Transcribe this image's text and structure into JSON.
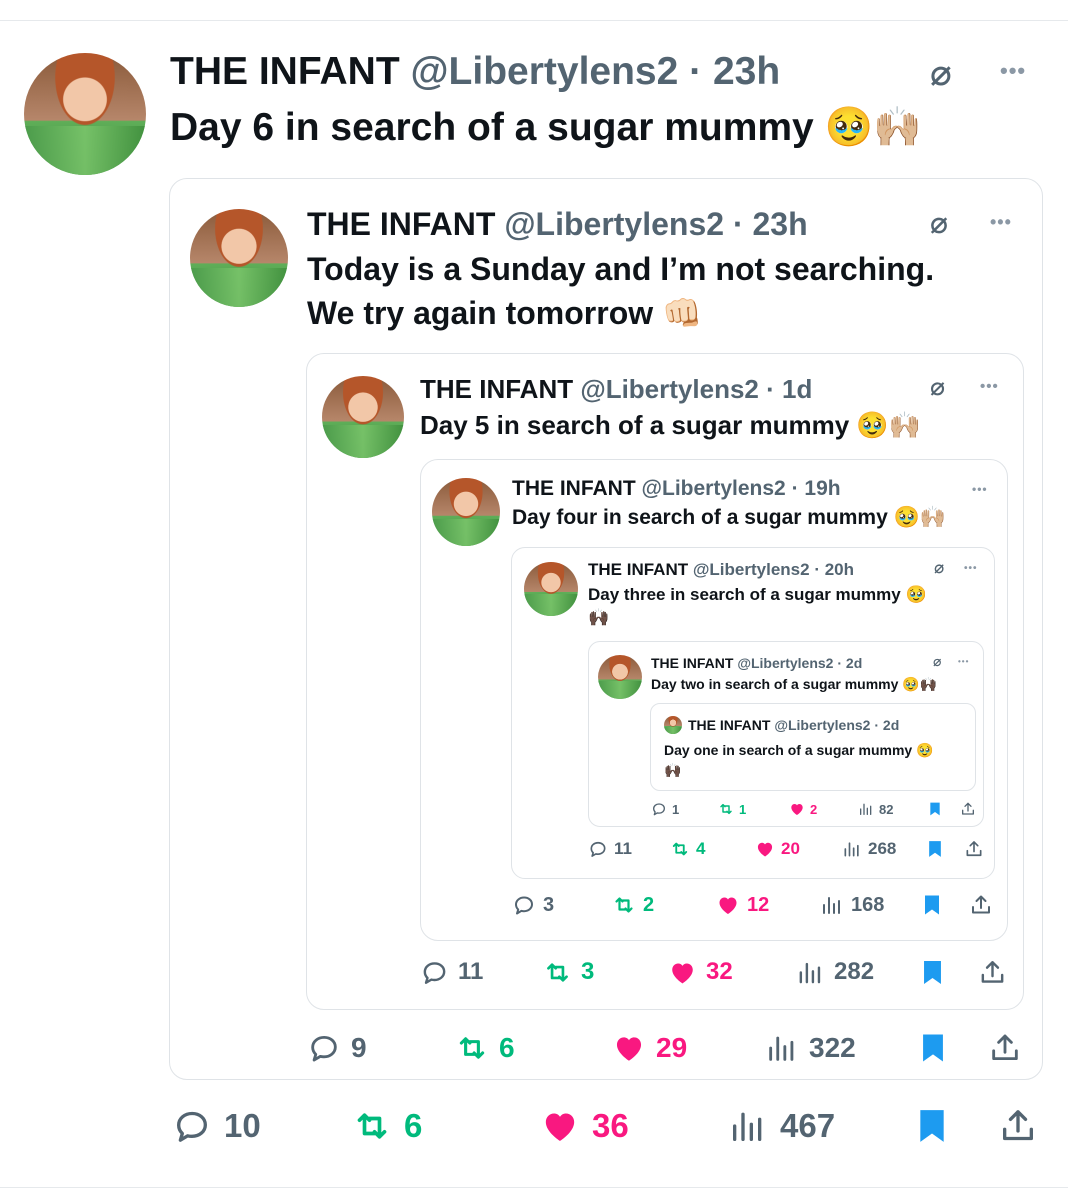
{
  "colors": {
    "handle": "#536471",
    "reply": "#536471",
    "retweet": "#00ba7c",
    "like": "#f91880",
    "bookmark": "#1d9bf0"
  },
  "icons": {
    "reply": "reply-icon",
    "retweet": "retweet-icon",
    "like": "heart-icon",
    "views": "views-icon",
    "bookmark": "bookmark-icon",
    "share": "share-icon",
    "grok": "grok-icon",
    "more": "more-icon"
  },
  "tweets": [
    {
      "name": "THE INFANT",
      "handle": "@Libertylens2",
      "time": "· 23h",
      "text": "Day 6 in search of a sugar mummy",
      "emoji": "🥹🙌🏼",
      "stats": {
        "replies": "10",
        "retweets": "6",
        "likes": "36",
        "views": "467"
      }
    },
    {
      "name": "THE INFANT",
      "handle": "@Libertylens2",
      "time": "· 23h",
      "text_line1": "Today is a Sunday and I’m not searching.",
      "text_line2": "We try again tomorrow",
      "emoji": "👊🏻",
      "stats": {
        "replies": "9",
        "retweets": "6",
        "likes": "29",
        "views": "322"
      }
    },
    {
      "name": "THE INFANT",
      "handle": "@Libertylens2",
      "time": "· 1d",
      "text": "Day 5 in search of a sugar mummy",
      "emoji": "🥹🙌🏼",
      "stats": {
        "replies": "11",
        "retweets": "3",
        "likes": "32",
        "views": "282"
      }
    },
    {
      "name": "THE INFANT",
      "handle": "@Libertylens2",
      "time": "· 19h",
      "text": "Day four in search of a sugar mummy",
      "emoji": "🥹🙌🏼",
      "stats": {
        "replies": "3",
        "retweets": "2",
        "likes": "12",
        "views": "168"
      }
    },
    {
      "name": "THE INFANT",
      "handle": "@Libertylens2",
      "time": "· 20h",
      "text": "Day three in search of a sugar mummy",
      "emoji": "🥹",
      "emoji2": "🙌🏿",
      "stats": {
        "replies": "11",
        "retweets": "4",
        "likes": "20",
        "views": "268"
      }
    },
    {
      "name": "THE INFANT",
      "handle": "@Libertylens2",
      "time": "· 2d",
      "text": "Day two in search of a sugar mummy",
      "emoji": "🥹🙌🏿",
      "stats": {
        "replies": "1",
        "retweets": "1",
        "likes": "2",
        "views": "82"
      }
    },
    {
      "name": "THE INFANT",
      "handle": "@Libertylens2",
      "time": "· 2d",
      "text": "Day one in search of a sugar mummy",
      "emoji": "🥹",
      "emoji2": "🙌🏿"
    }
  ],
  "more_glyph": "•••",
  "grok_glyph": "⌀"
}
